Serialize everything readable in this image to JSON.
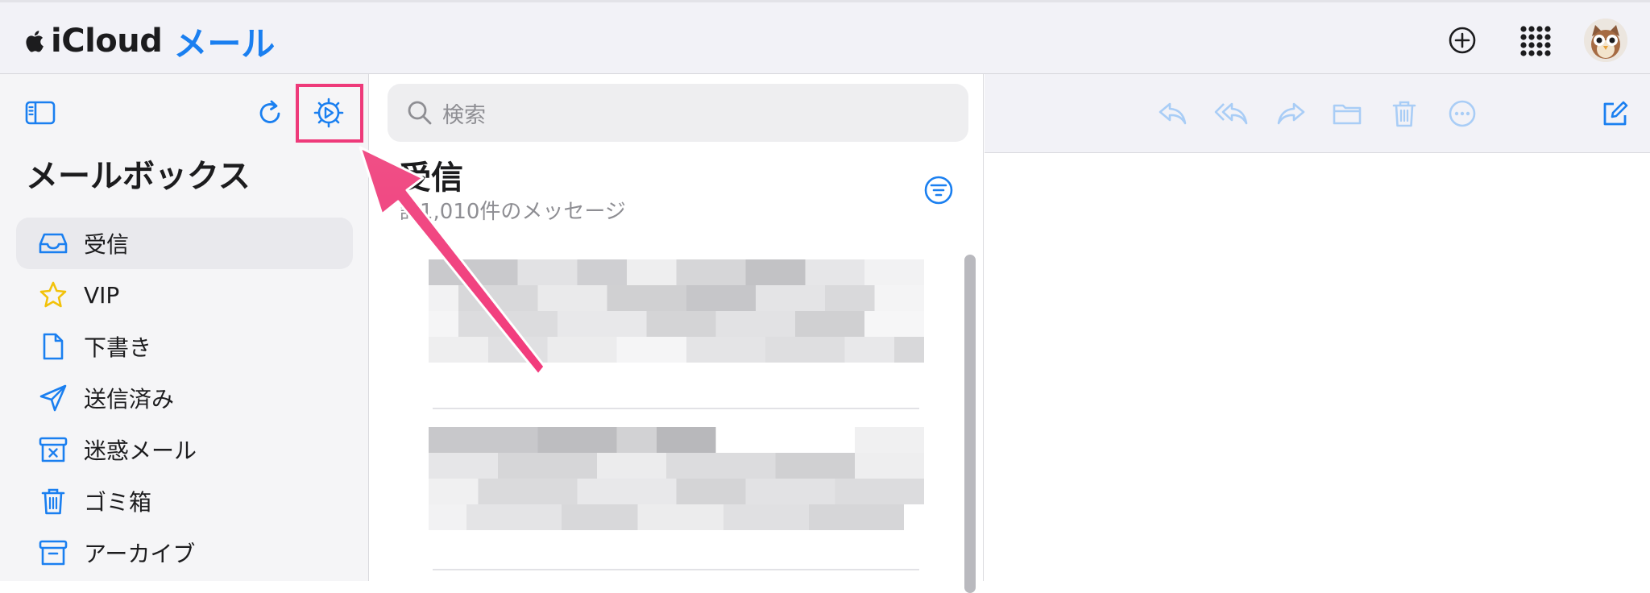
{
  "app": {
    "brand_text": "iCloud",
    "app_name": "メール",
    "brand_color": "#1a7ff0"
  },
  "header": {
    "icons": [
      "apple-logo-icon",
      "plus-circle-icon",
      "app-grid-icon",
      "avatar"
    ]
  },
  "sidebar": {
    "title": "メールボックス",
    "toolbar_icons": [
      "sidebar-toggle-icon",
      "refresh-icon",
      "settings-gear-icon"
    ],
    "items": [
      {
        "label": "受信",
        "icon": "inbox-tray-icon",
        "selected": true
      },
      {
        "label": "VIP",
        "icon": "star-icon",
        "selected": false
      },
      {
        "label": "下書き",
        "icon": "document-icon",
        "selected": false
      },
      {
        "label": "送信済み",
        "icon": "paper-plane-icon",
        "selected": false
      },
      {
        "label": "迷惑メール",
        "icon": "junk-box-icon",
        "selected": false
      },
      {
        "label": "ゴミ箱",
        "icon": "trash-icon",
        "selected": false
      },
      {
        "label": "アーカイブ",
        "icon": "archive-box-icon",
        "selected": false
      }
    ]
  },
  "message_list": {
    "search_placeholder": "検索",
    "mailbox_title": "受信",
    "message_count_text": "計1,010件のメッセージ"
  },
  "detail_toolbar": {
    "icons": [
      "reply-icon",
      "reply-all-icon",
      "forward-icon",
      "folder-icon",
      "trash-icon",
      "more-icon",
      "compose-icon"
    ]
  },
  "annotation": {
    "highlight_color": "#ee3a7a"
  }
}
